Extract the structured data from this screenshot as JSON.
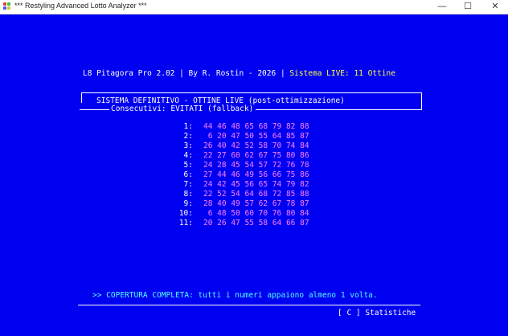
{
  "window": {
    "title": "Restyling Advanced Lotto Analyzer",
    "title_prefix": "***",
    "title_suffix": "***",
    "minimize": "—",
    "maximize": "☐",
    "close": "✕"
  },
  "header": {
    "left": "L8 Pitagora Pro 2.02 | By R. Rostin - 2026 | ",
    "right": "Sistema LIVE: 11 Ottine"
  },
  "box": {
    "title": "SISTEMA DEFINITIVO - OTTINE LIVE (post-ottimizzazione)",
    "subtitle": "Consecutivi: EVITATI (fallback)"
  },
  "rows": [
    {
      "label": "1:",
      "numbers": "44 46 48 65 68 79 82 88"
    },
    {
      "label": "2:",
      "numbers": " 6 20 47 50 55 64 85 87"
    },
    {
      "label": "3:",
      "numbers": "26 40 42 52 58 70 74 84"
    },
    {
      "label": "4:",
      "numbers": "22 27 60 62 67 75 80 86"
    },
    {
      "label": "5:",
      "numbers": "24 28 45 54 57 72 76 78"
    },
    {
      "label": "6:",
      "numbers": "27 44 46 49 56 66 75 86"
    },
    {
      "label": "7:",
      "numbers": "24 42 45 56 65 74 79 82"
    },
    {
      "label": "8:",
      "numbers": "22 52 54 64 68 72 85 88"
    },
    {
      "label": "9:",
      "numbers": "28 40 49 57 62 67 78 87"
    },
    {
      "label": "10:",
      "numbers": " 6 48 50 60 70 76 80 84"
    },
    {
      "label": "11:",
      "numbers": "20 26 47 55 58 64 66 87"
    }
  ],
  "coverage": ">> COPERTURA COMPLETA: tutti i numeri appaiono almeno 1 volta.",
  "footer": {
    "statistics": "[ C ] Statistiche"
  },
  "colors": {
    "background": "#0000f0",
    "text": "#ffffff",
    "accent": "#ffff40",
    "numbers": "#ff80ff",
    "coverage": "#55ffff"
  }
}
